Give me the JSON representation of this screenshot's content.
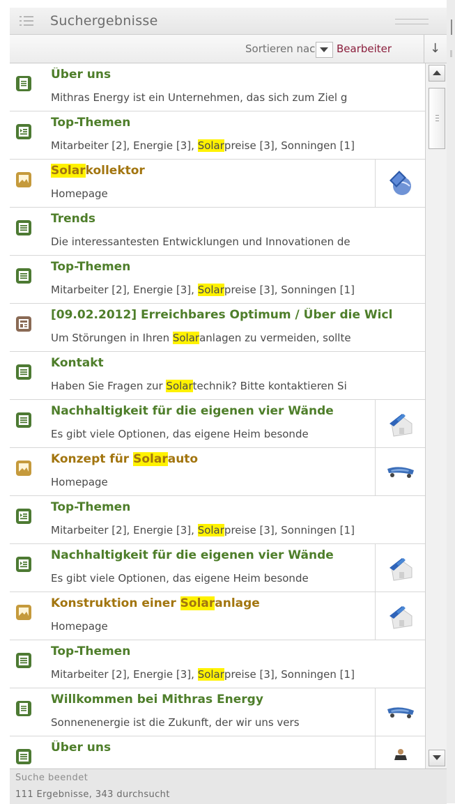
{
  "panel": {
    "title": "Suchergebnisse"
  },
  "sort": {
    "label": "Sortieren nach:",
    "value": "Bearbeiter",
    "direction": "↓"
  },
  "colors": {
    "title_green": "#4e7e2a",
    "title_gold": "#a2750f",
    "highlight": "#fff200",
    "sort_value": "#8a1d3b"
  },
  "results": [
    {
      "kind": "doc",
      "icon": "page-icon",
      "title": [
        {
          "t": "Über uns"
        }
      ],
      "desc": [
        {
          "t": "Mithras Energy ist ein Unternehmen, das sich zum Ziel g"
        }
      ]
    },
    {
      "kind": "doc",
      "icon": "list-page-icon",
      "title": [
        {
          "t": "Top-Themen"
        }
      ],
      "desc": [
        {
          "t": "Mitarbeiter [2], Energie [3], "
        },
        {
          "t": "Solar",
          "hl": true
        },
        {
          "t": "preise [3], Sonningen [1]"
        }
      ]
    },
    {
      "kind": "image",
      "icon": "image-icon",
      "thumb": "globe",
      "title": [
        {
          "t": "Solar",
          "hl": true
        },
        {
          "t": "kollektor"
        }
      ],
      "desc": [
        {
          "t": "Homepage"
        }
      ]
    },
    {
      "kind": "doc",
      "icon": "text-page-icon",
      "title": [
        {
          "t": "Trends"
        }
      ],
      "desc": [
        {
          "t": "Die interessantesten Entwicklungen und Innovationen de"
        }
      ]
    },
    {
      "kind": "doc",
      "icon": "text-page-icon",
      "title": [
        {
          "t": "Top-Themen"
        }
      ],
      "desc": [
        {
          "t": "Mitarbeiter [2], Energie [3], "
        },
        {
          "t": "Solar",
          "hl": true
        },
        {
          "t": "preise [3], Sonningen [1]"
        }
      ]
    },
    {
      "kind": "doc",
      "icon": "news-icon",
      "title": [
        {
          "t": "[09.02.2012] Erreichbares Optimum / Über die Wicl"
        }
      ],
      "desc": [
        {
          "t": "Um Störungen in Ihren "
        },
        {
          "t": "Solar",
          "hl": true
        },
        {
          "t": "anlagen zu vermeiden, sollte"
        }
      ]
    },
    {
      "kind": "doc",
      "icon": "text-page-icon",
      "title": [
        {
          "t": "Kontakt"
        }
      ],
      "desc": [
        {
          "t": "Haben Sie Fragen zur "
        },
        {
          "t": "Solar",
          "hl": true
        },
        {
          "t": "technik? Bitte kontaktieren Si"
        }
      ]
    },
    {
      "kind": "doc",
      "icon": "text-page-icon",
      "thumb": "house",
      "title": [
        {
          "t": "Nachhaltigkeit für die eigenen vier Wände"
        }
      ],
      "desc": [
        {
          "t": "Es gibt viele Optionen, das eigene Heim besonde"
        }
      ]
    },
    {
      "kind": "image",
      "icon": "image-icon",
      "thumb": "car",
      "title": [
        {
          "t": "Konzept für "
        },
        {
          "t": "Solar",
          "hl": true
        },
        {
          "t": "auto"
        }
      ],
      "desc": [
        {
          "t": "Homepage"
        }
      ]
    },
    {
      "kind": "doc",
      "icon": "list-page-icon",
      "title": [
        {
          "t": "Top-Themen"
        }
      ],
      "desc": [
        {
          "t": "Mitarbeiter [2], Energie [3], "
        },
        {
          "t": "Solar",
          "hl": true
        },
        {
          "t": "preise [3], Sonningen [1]"
        }
      ]
    },
    {
      "kind": "doc",
      "icon": "list-page-icon",
      "thumb": "house",
      "title": [
        {
          "t": "Nachhaltigkeit für die eigenen vier Wände"
        }
      ],
      "desc": [
        {
          "t": "Es gibt viele Optionen, das eigene Heim besonde"
        }
      ]
    },
    {
      "kind": "image",
      "icon": "image-icon",
      "thumb": "house",
      "title": [
        {
          "t": "Konstruktion einer "
        },
        {
          "t": "Solar",
          "hl": true
        },
        {
          "t": "anlage"
        }
      ],
      "desc": [
        {
          "t": "Homepage"
        }
      ]
    },
    {
      "kind": "doc",
      "icon": "text-page-icon",
      "title": [
        {
          "t": "Top-Themen"
        }
      ],
      "desc": [
        {
          "t": "Mitarbeiter [2], Energie [3], "
        },
        {
          "t": "Solar",
          "hl": true
        },
        {
          "t": "preise [3], Sonningen [1]"
        }
      ]
    },
    {
      "kind": "doc",
      "icon": "page-icon",
      "thumb": "car",
      "title": [
        {
          "t": "Willkommen bei Mithras Energy"
        }
      ],
      "desc": [
        {
          "t": "Sonnenenergie ist die Zukunft, der wir uns vers"
        }
      ]
    },
    {
      "kind": "doc",
      "icon": "text-page-icon",
      "thumb": "person",
      "title": [
        {
          "t": "Über uns"
        }
      ],
      "desc": []
    }
  ],
  "footer": {
    "status": "Suche beendet",
    "counts": "111 Ergebnisse, 343 durchsucht"
  }
}
